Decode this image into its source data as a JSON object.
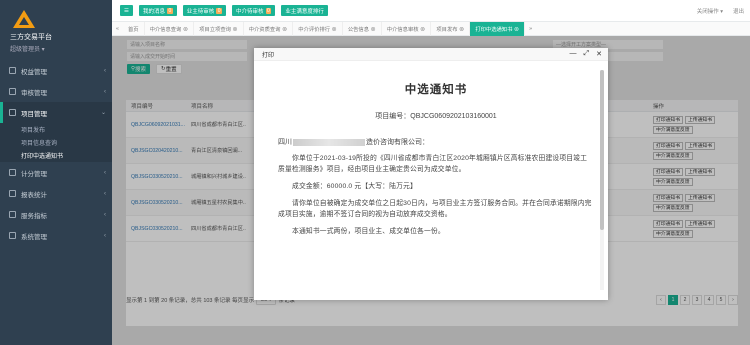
{
  "sidebar": {
    "brand": "三方交易平台",
    "user": "超级管理员 ▾",
    "items": [
      {
        "label": "权益管理",
        "active": false
      },
      {
        "label": "审核管理",
        "active": false
      },
      {
        "label": "项目管理",
        "active": true
      },
      {
        "label": "计分管理",
        "active": false
      },
      {
        "label": "报表统计",
        "active": false
      },
      {
        "label": "服务指标",
        "active": false
      },
      {
        "label": "系统管理",
        "active": false
      }
    ],
    "subitems": [
      "项目发布",
      "项目信息查询",
      "打印中选通知书"
    ]
  },
  "topbar": {
    "buttons": [
      {
        "label": "我的消息",
        "badge": "0"
      },
      {
        "label": "业主待审核",
        "badge": "0"
      },
      {
        "label": "中介待审核",
        "badge": "0"
      },
      {
        "label": "业主满意度排行",
        "badge": ""
      }
    ],
    "right": [
      "关闭操作 ▾",
      "退出"
    ]
  },
  "tabs": [
    "首页",
    "中介信息查询 ⊗",
    "项目立项查询 ⊗",
    "中介资质查询 ⊗",
    "中介评价排行 ⊗",
    "公告信息 ⊗",
    "中介信息审核 ⊗",
    "项目发布 ⊗",
    "打印中选通知书 ⊗"
  ],
  "active_tab_index": 8,
  "search": {
    "placeholder1": "请输入项目名称",
    "placeholder2": "请输入成交开始时间",
    "right_placeholder1": "—选择开工方案类型—",
    "right_placeholder2": "请输入成交结束时间",
    "search_label": "搜索",
    "reset_label": "重置"
  },
  "table": {
    "headers": [
      "项目编号",
      "项目名称",
      "操作"
    ],
    "rows": [
      {
        "id": "QBJCG06092021031...",
        "name": "四川省成都市青白江区..."
      },
      {
        "id": "QBJSGC020420210...",
        "name": "青白江区清泉镇回澜..."
      },
      {
        "id": "QBJSGC030520210...",
        "name": "城厢镇和兴村城乡建设..."
      },
      {
        "id": "QBJSGC030520210...",
        "name": "城厢镇五星村农民集中..."
      },
      {
        "id": "QBJSGC030520210...",
        "name": "四川省成都市青白江区..."
      }
    ],
    "op_print": "打印通知书",
    "op_upload": "上传通知书",
    "op_feedback": "中介满意度反馈"
  },
  "pager": {
    "summary": "显示第 1 到第 20 条记录，总共 103 条记录 每页显示",
    "per_page": "20 ▾",
    "suffix": "条记录",
    "pages": [
      "‹",
      "1",
      "2",
      "3",
      "4",
      "5",
      "›"
    ]
  },
  "modal": {
    "title": "打印",
    "controls": [
      "—",
      "⤢",
      "✕"
    ],
    "doc": {
      "heading": "中选通知书",
      "project_no": "项目编号：QBJCG0609202103160001",
      "addr_prefix": "四川",
      "addr_suffix": "造价咨询有限公司：",
      "para1": "你单位于2021-03-19所投的《四川省成都市青白江区2020年城厢镇片区高标准农田建设项目竣工质量检测服务》项目，经由项目业主确定贵公司为成交单位。",
      "amount": "成交金额：60000.0 元【大写：陆万元】",
      "para2": "请你单位自被确定为成交单位之日起30日内，与项目业主方签订服务合同。并在合同承诺期限内完成项目实施，逾期不签订合同的视为自动放弃成交资格。",
      "para3": "本通知书一式两份，项目业主、成交单位各一份。"
    }
  }
}
